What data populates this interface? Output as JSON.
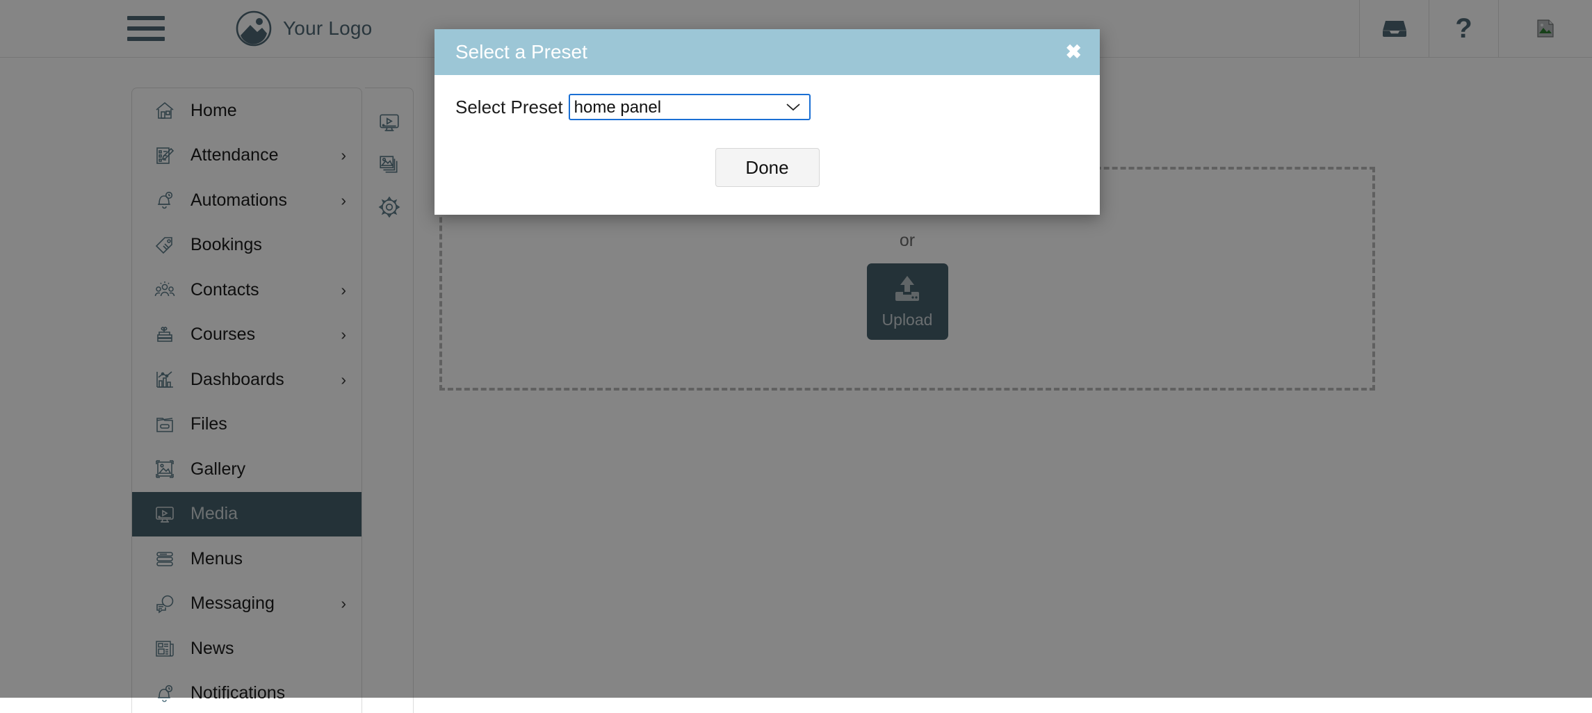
{
  "header": {
    "menu_icon": "hamburger-icon",
    "logo_icon": "image-circle-logo-icon",
    "logo_text": "Your Logo",
    "actions": [
      {
        "icon": "inbox-icon",
        "label": ""
      },
      {
        "icon": "question-mark-help-icon",
        "label": "?"
      },
      {
        "icon": "broken-image-icon",
        "label": ""
      }
    ]
  },
  "sidebar": {
    "items": [
      {
        "label": "Home",
        "icon": "home-icon",
        "chevron": "",
        "active": false
      },
      {
        "label": "Attendance",
        "icon": "attendance-icon",
        "chevron": "›",
        "active": false
      },
      {
        "label": "Automations",
        "icon": "bell-clock-icon",
        "chevron": "›",
        "active": false
      },
      {
        "label": "Bookings",
        "icon": "tag-icon",
        "chevron": "",
        "active": false
      },
      {
        "label": "Contacts",
        "icon": "people-icon",
        "chevron": "›",
        "active": false
      },
      {
        "label": "Courses",
        "icon": "books-plant-icon",
        "chevron": "›",
        "active": false
      },
      {
        "label": "Dashboards",
        "icon": "bar-chart-icon",
        "chevron": "›",
        "active": false
      },
      {
        "label": "Files",
        "icon": "folder-file-icon",
        "chevron": "",
        "active": false
      },
      {
        "label": "Gallery",
        "icon": "gallery-image-icon",
        "chevron": "",
        "active": false
      },
      {
        "label": "Media",
        "icon": "media-monitor-icon",
        "chevron": "",
        "active": true
      },
      {
        "label": "Menus",
        "icon": "menu-lines-icon",
        "chevron": "",
        "active": false
      },
      {
        "label": "Messaging",
        "icon": "chat-bubbles-icon",
        "chevron": "›",
        "active": false
      },
      {
        "label": "News",
        "icon": "newspaper-icon",
        "chevron": "",
        "active": false
      },
      {
        "label": "Notifications",
        "icon": "bell-clock-icon",
        "chevron": "",
        "active": false
      }
    ]
  },
  "media_page": {
    "rail": [
      {
        "icon": "media-monitor-icon"
      },
      {
        "icon": "images-stack-icon"
      },
      {
        "icon": "gear-icon"
      }
    ],
    "title": "",
    "dropzone": {
      "drag_text": "",
      "or_text": "or",
      "upload_label": "Upload",
      "upload_icon": "upload-arrow-icon"
    }
  },
  "modal": {
    "title": "Select a Preset",
    "close_label": "✖",
    "preset_label": "Select Preset",
    "preset_value": "home panel",
    "preset_options": [
      "home panel"
    ],
    "done_label": "Done"
  },
  "colors": {
    "modal_header": "#9cc6d6",
    "accent_slate": "#46606b",
    "icon_stroke": "#5d7b88",
    "focus_blue": "#1a6fd4",
    "overlay": "rgba(0,0,0,0.48)"
  }
}
